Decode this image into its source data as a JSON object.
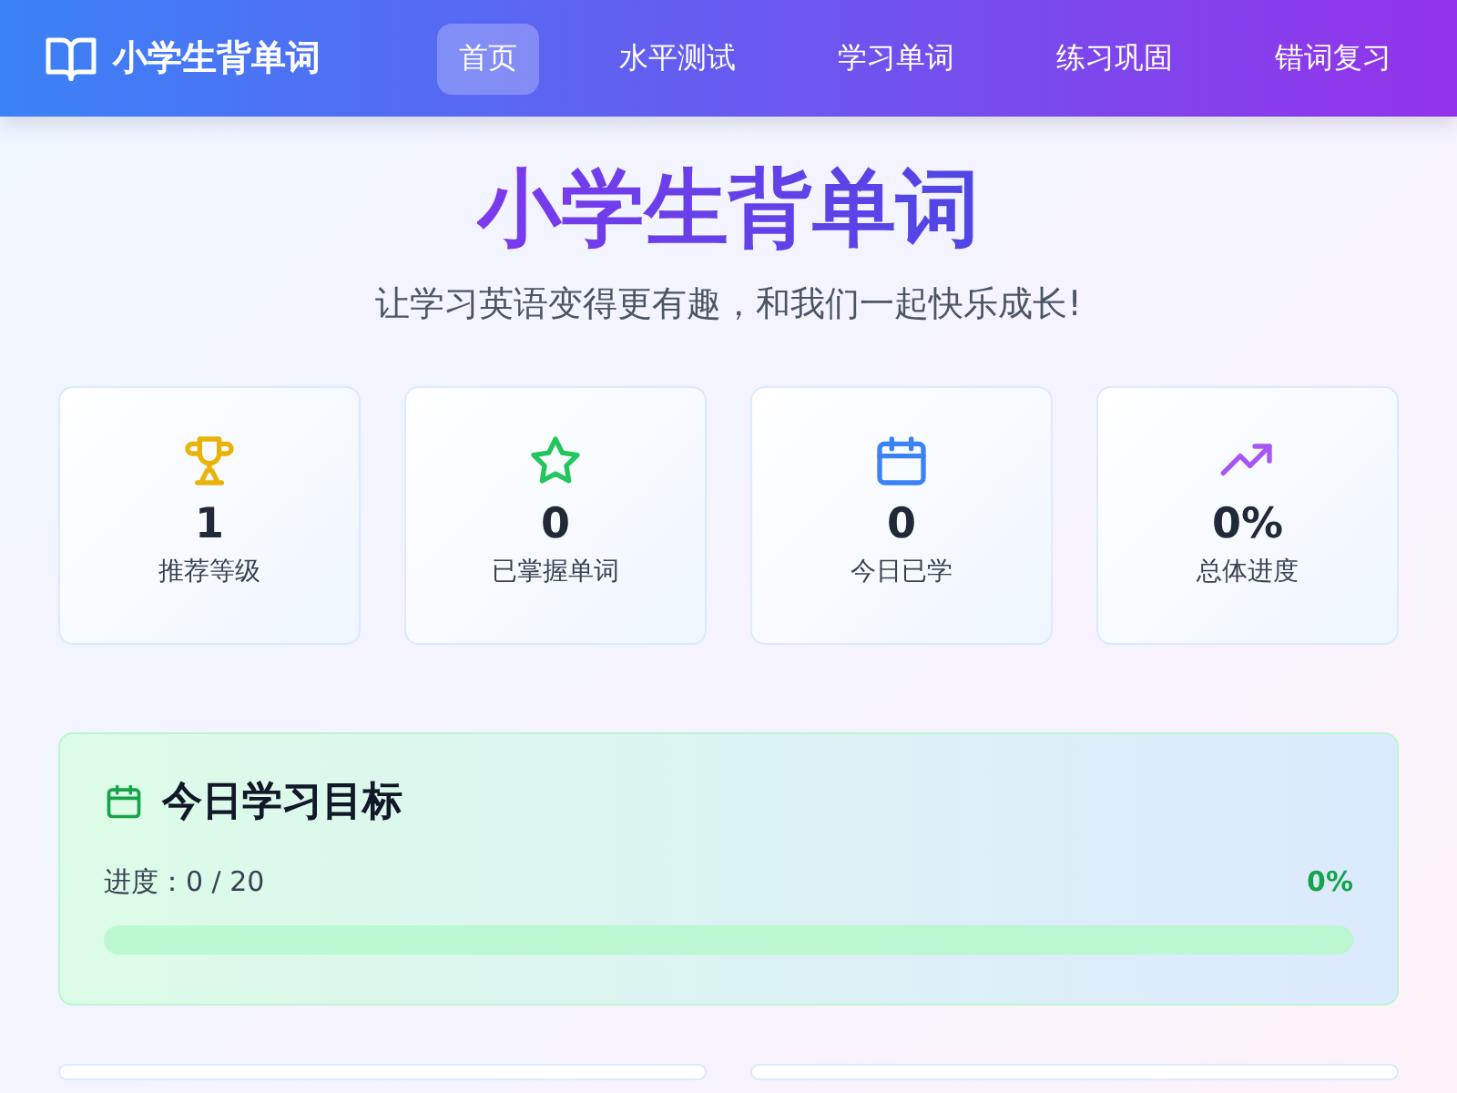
{
  "header": {
    "logo": "小学生背单词",
    "nav": [
      {
        "label": "首页",
        "selected": true
      },
      {
        "label": "水平测试",
        "selected": false
      },
      {
        "label": "学习单词",
        "selected": false
      },
      {
        "label": "练习巩固",
        "selected": false
      },
      {
        "label": "错词复习",
        "selected": false
      }
    ]
  },
  "hero": {
    "title": "小学生背单词",
    "subtitle": "让学习英语变得更有趣，和我们一起快乐成长!"
  },
  "stats": [
    {
      "kind": "trophy",
      "color": "#eab308",
      "value": "1",
      "label": "推荐等级"
    },
    {
      "kind": "star",
      "color": "#22c55e",
      "value": "0",
      "label": "已掌握单词"
    },
    {
      "kind": "calendar",
      "color": "#3b82f6",
      "value": "0",
      "label": "今日已学"
    },
    {
      "kind": "trend",
      "color": "#a855f7",
      "value": "0%",
      "label": "总体进度"
    }
  ],
  "goal": {
    "title": "今日学习目标",
    "progress_text": "进度：0 / 20",
    "percent": "0%",
    "level": 0
  }
}
